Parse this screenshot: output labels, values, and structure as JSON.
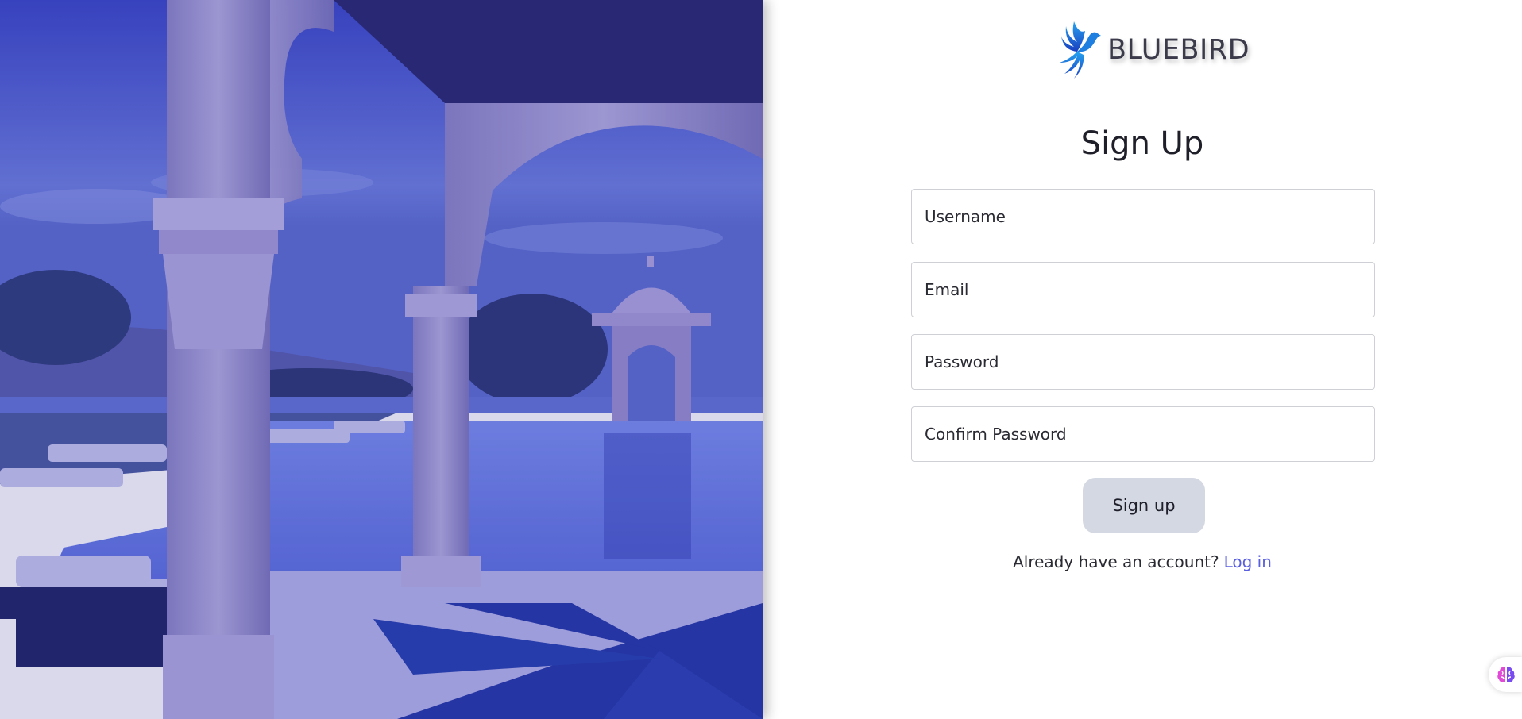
{
  "brand": {
    "name": "BLUEBIRD"
  },
  "form": {
    "title": "Sign Up",
    "username_placeholder": "Username",
    "email_placeholder": "Email",
    "password_placeholder": "Password",
    "confirm_password_placeholder": "Confirm Password",
    "submit_label": "Sign up"
  },
  "footer": {
    "prompt": "Already have an account?",
    "login_link": "Log in"
  },
  "icons": {
    "logo": "bluebird-logo-icon",
    "assistant": "brain-assistant-icon"
  },
  "colors": {
    "hero_overlay": "#2a2f8f",
    "accent_link": "#5a5fe0",
    "button_bg": "#d3d8e2",
    "logo_blue": "#1a73e8"
  }
}
